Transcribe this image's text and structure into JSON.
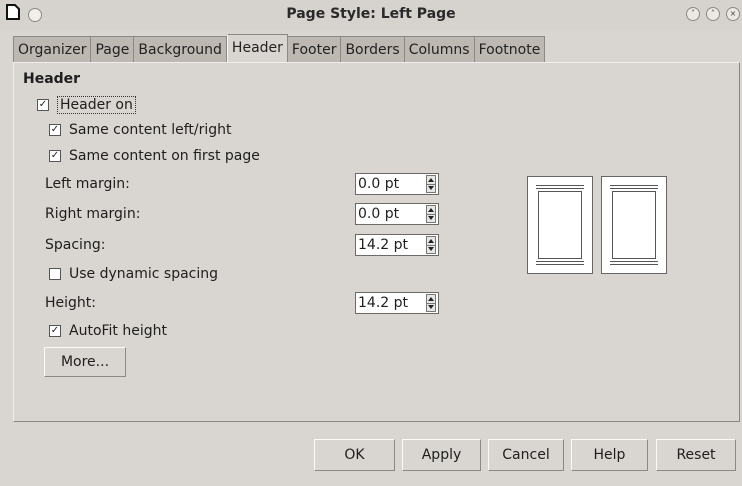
{
  "window": {
    "title": "Page Style: Left Page"
  },
  "tabs": [
    {
      "label": "Organizer",
      "active": false
    },
    {
      "label": "Page",
      "active": false
    },
    {
      "label": "Background",
      "active": false
    },
    {
      "label": "Header",
      "active": true
    },
    {
      "label": "Footer",
      "active": false
    },
    {
      "label": "Borders",
      "active": false
    },
    {
      "label": "Columns",
      "active": false
    },
    {
      "label": "Footnote",
      "active": false
    }
  ],
  "header": {
    "section_title": "Header",
    "header_on": {
      "label": "Header on",
      "checked": true
    },
    "same_left_right": {
      "label": "Same content left/right",
      "checked": true
    },
    "same_first_page": {
      "label": "Same content on first page",
      "checked": true
    },
    "left_margin": {
      "label": "Left margin:",
      "value": "0.0 pt"
    },
    "right_margin": {
      "label": "Right margin:",
      "value": "0.0 pt"
    },
    "spacing": {
      "label": "Spacing:",
      "value": "14.2 pt"
    },
    "dynamic_spacing": {
      "label": "Use dynamic spacing",
      "checked": false
    },
    "height": {
      "label": "Height:",
      "value": "14.2 pt"
    },
    "autofit": {
      "label": "AutoFit height",
      "checked": true
    },
    "more_label": "More..."
  },
  "buttons": {
    "ok": "OK",
    "apply": "Apply",
    "cancel": "Cancel",
    "help": "Help",
    "reset": "Reset"
  },
  "icons": {
    "app": "document-icon",
    "minimize": "chevron-down-icon",
    "maximize": "chevron-up-icon",
    "close": "close-icon"
  },
  "colors": {
    "window_bg": "#d9d5d0",
    "inactive_tab_bg": "#bdb8b2"
  }
}
